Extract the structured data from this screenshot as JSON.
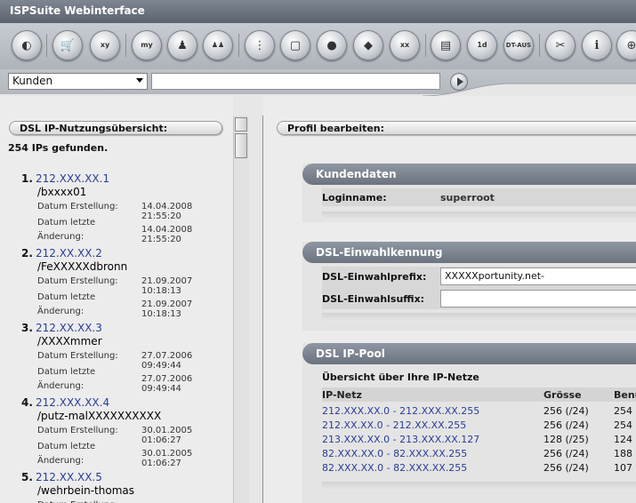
{
  "app": {
    "title": "ISPSuite Webinterface"
  },
  "toolbar": {
    "buttons": [
      {
        "name": "back-icon",
        "glyph": "◐"
      },
      {
        "name": "cart-icon",
        "glyph": "🛒"
      },
      {
        "name": "cube-xy-icon",
        "glyph": "xy"
      },
      {
        "name": "my-user-icon",
        "glyph": "my"
      },
      {
        "name": "user-icon",
        "glyph": "♟"
      },
      {
        "name": "users-icon",
        "glyph": "♟♟"
      },
      {
        "name": "hierarchy-icon",
        "glyph": "⋮"
      },
      {
        "name": "box-icon",
        "glyph": "▢"
      },
      {
        "name": "cluster-icon",
        "glyph": "●"
      },
      {
        "name": "diamond-icon",
        "glyph": "◆"
      },
      {
        "name": "wrench-xx-icon",
        "glyph": "xx"
      },
      {
        "name": "document-icon",
        "glyph": "▤"
      },
      {
        "name": "document-1d-icon",
        "glyph": "1d"
      },
      {
        "name": "dt-aus-icon",
        "glyph": "DT-AUS"
      },
      {
        "name": "tools-icon",
        "glyph": "✂"
      },
      {
        "name": "info-icon",
        "glyph": "i"
      },
      {
        "name": "exit-icon",
        "glyph": "⊕"
      }
    ]
  },
  "search": {
    "selected": "Kunden",
    "value": ""
  },
  "left": {
    "header": "DSL IP-Nutzungsübersicht:",
    "found": "254 IPs gefunden.",
    "label_created": "Datum Erstellung:",
    "label_changed_1": "Datum letzte",
    "label_changed_2": "Änderung:",
    "entries": [
      {
        "num": "1.",
        "ip": "212.XXX.XX.1",
        "name": "/bxxxx01",
        "created": "14.04.2008 21:55:20",
        "changed": "14.04.2008 21:55:20"
      },
      {
        "num": "2.",
        "ip": "212.XX.XX.2",
        "name": "/FeXXXXXdbronn",
        "created": "21.09.2007 10:18:13",
        "changed": "21.09.2007 10:18:13"
      },
      {
        "num": "3.",
        "ip": "212.XX.XX.3",
        "name": "/XXXXmmer",
        "created": "27.07.2006 09:49:44",
        "changed": "27.07.2006 09:49:44"
      },
      {
        "num": "4.",
        "ip": "212.XXX.XX.4",
        "name": "/putz-malXXXXXXXXXX",
        "created": "30.01.2005 01:06:27",
        "changed": "30.01.2005 01:06:27"
      },
      {
        "num": "5.",
        "ip": "212.XX.XX.5",
        "name": "/wehrbein-thomas",
        "created": "",
        "changed": ""
      }
    ]
  },
  "right": {
    "header": "Profil bearbeiten:",
    "kundendaten": {
      "title": "Kundendaten",
      "login_label": "Loginname:",
      "login_value": "superroot"
    },
    "dsl": {
      "title": "DSL-Einwahlkennung",
      "prefix_label": "DSL-Einwahlprefix:",
      "prefix_value": "XXXXXportunity.net-",
      "suffix_label": "DSL-Einwahlsuffix:",
      "suffix_value": ""
    },
    "pool": {
      "title": "DSL IP-Pool",
      "subtitle": "Übersicht über Ihre IP-Netze",
      "columns": [
        "IP-Netz",
        "Grösse",
        "Benu"
      ],
      "rows": [
        {
          "net": "212.XXX.XX.0 - 212.XXX.XX.255",
          "size": "256 (/24)",
          "used": "254"
        },
        {
          "net": "212.XX.XX.0 - 212.XX.XX.255",
          "size": "256 (/24)",
          "used": "254"
        },
        {
          "net": "213.XXX.XX.0 - 213.XXX.XX.127",
          "size": "128 (/25)",
          "used": "124"
        },
        {
          "net": "82.XXX.XX.0 - 82.XXX.XX.255",
          "size": "256 (/24)",
          "used": "188"
        },
        {
          "net": "82.XXX.XX.0 - 82.XXX.XX.255",
          "size": "256 (/24)",
          "used": "107"
        }
      ]
    }
  }
}
